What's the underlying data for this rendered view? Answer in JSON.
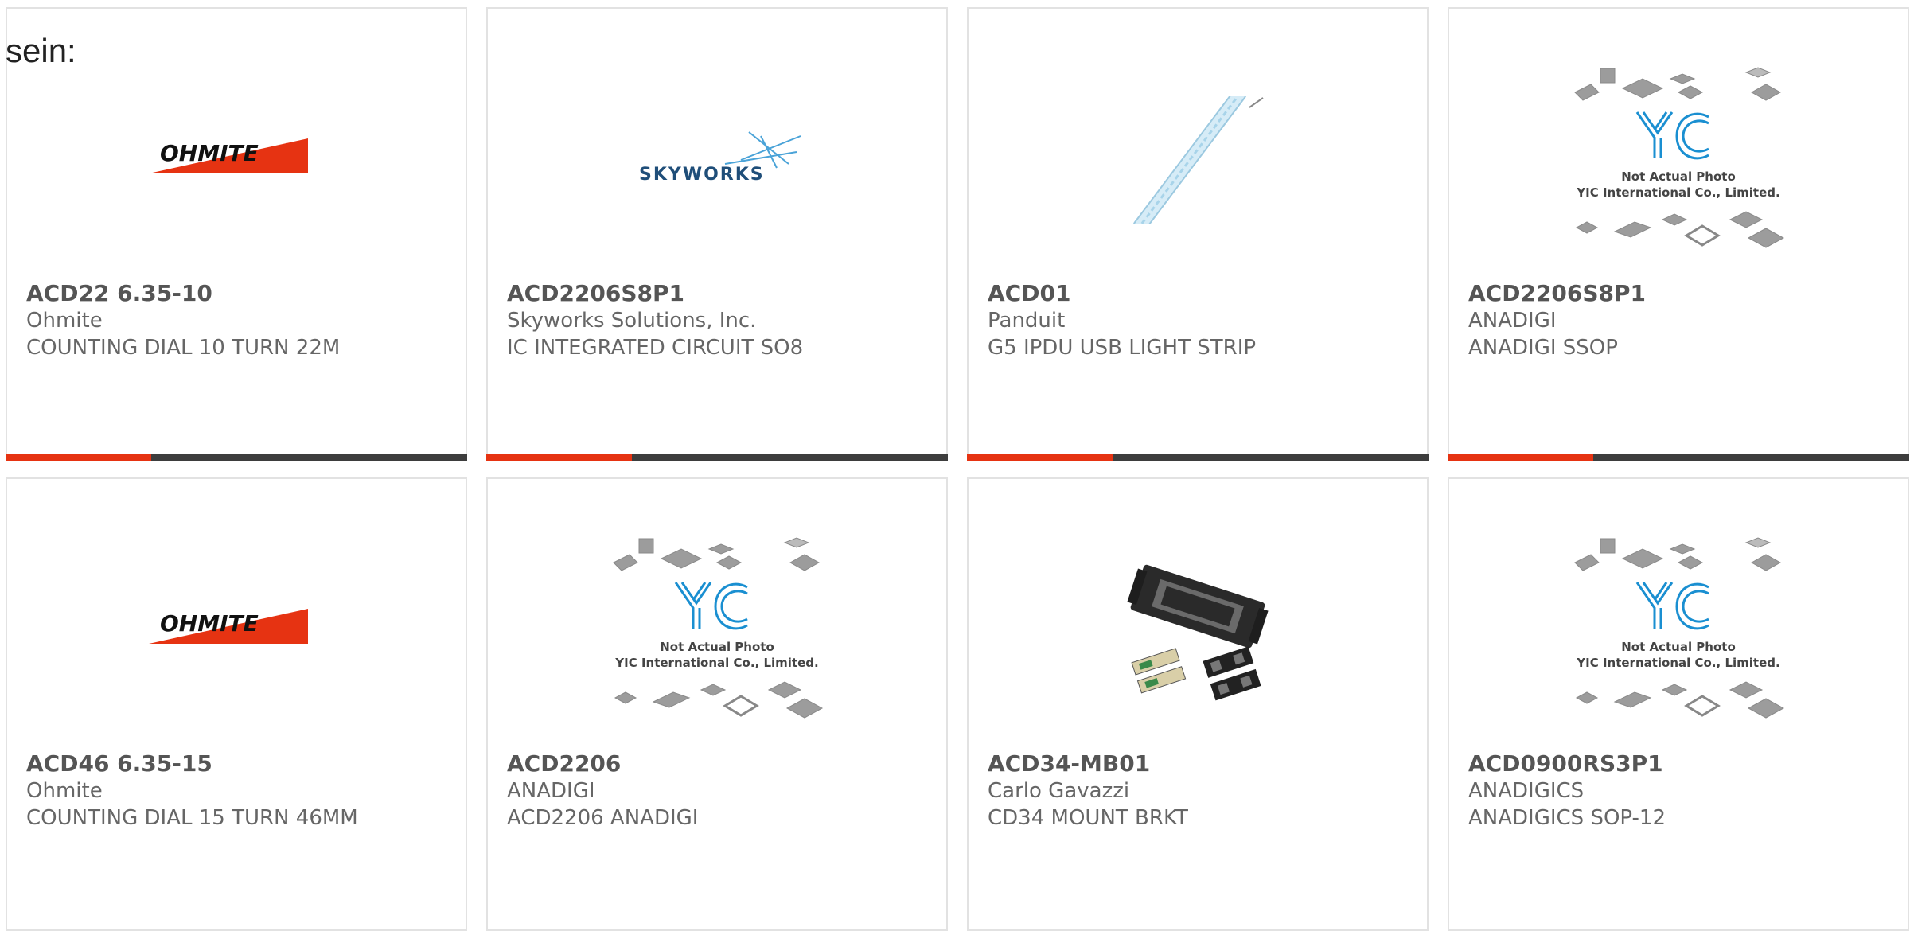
{
  "intro_text": "sein:",
  "colors": {
    "accent": "#e63312",
    "bar": "#3d3d3d",
    "border": "#e2e2e2"
  },
  "products": [
    {
      "part_number": "ACD22 6.35-10",
      "manufacturer": "Ohmite",
      "description": "COUNTING DIAL 10 TURN 22M",
      "image": "ohmite-logo",
      "logo_text": "OHMITE"
    },
    {
      "part_number": "ACD2206S8P1",
      "manufacturer": "Skyworks Solutions, Inc.",
      "description": "IC INTEGRATED CIRCUIT SO8",
      "image": "skyworks-logo",
      "logo_text": "SKYWORKS"
    },
    {
      "part_number": "ACD01",
      "manufacturer": "Panduit",
      "description": "G5 IPDU USB LIGHT STRIP",
      "image": "light-strip-photo"
    },
    {
      "part_number": "ACD2206S8P1",
      "manufacturer": "ANADIGI",
      "description": "ANADIGI SSOP",
      "image": "placeholder-photo",
      "placeholder_line1": "Not Actual Photo",
      "placeholder_line2": "YIC International Co., Limited."
    },
    {
      "part_number": "ACD46 6.35-15",
      "manufacturer": "Ohmite",
      "description": "COUNTING DIAL 15 TURN 46MM",
      "image": "ohmite-logo",
      "logo_text": "OHMITE"
    },
    {
      "part_number": "ACD2206",
      "manufacturer": "ANADIGI",
      "description": "ACD2206 ANADIGI",
      "image": "placeholder-photo",
      "placeholder_line1": "Not Actual Photo",
      "placeholder_line2": "YIC International Co., Limited."
    },
    {
      "part_number": "ACD34-MB01",
      "manufacturer": "Carlo Gavazzi",
      "description": "CD34 MOUNT BRKT",
      "image": "mount-bracket-photo"
    },
    {
      "part_number": "ACD0900RS3P1",
      "manufacturer": "ANADIGICS",
      "description": "ANADIGICS SOP-12",
      "image": "placeholder-photo",
      "placeholder_line1": "Not Actual Photo",
      "placeholder_line2": "YIC International Co., Limited."
    }
  ]
}
